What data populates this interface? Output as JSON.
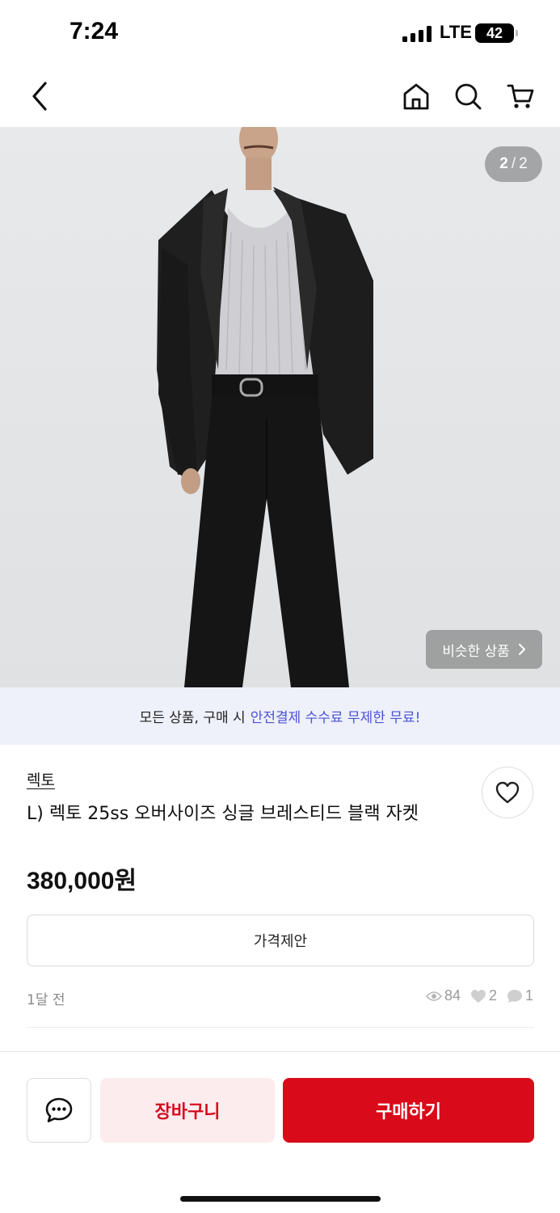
{
  "status_bar": {
    "time": "7:24",
    "network": "LTE",
    "battery": "42"
  },
  "nav": {
    "icons": [
      "back-icon",
      "home-icon",
      "search-icon",
      "cart-icon"
    ]
  },
  "hero": {
    "counter_current": "2",
    "counter_sep": "/",
    "counter_total": "2",
    "similar_label": "비슷한 상품"
  },
  "promo": {
    "text": "모든 상품, 구매 시",
    "highlight": "안전결제 수수료 무제한 무료!"
  },
  "product": {
    "brand": "렉토",
    "title": "L) 렉토 25ss 오버사이즈 싱글 브레스티드  블랙 자켓",
    "price": "380,000",
    "currency": "원",
    "offer_label": "가격제안",
    "time_ago": "1달 전",
    "views": "84",
    "likes": "2",
    "chats": "1"
  },
  "actions": {
    "cart_label": "장바구니",
    "buy_label": "구매하기"
  },
  "colors": {
    "accent": "#d90a19",
    "cart_bg": "#fdecee",
    "promo_bg": "#eef0fa",
    "promo_highlight": "#4a52d6"
  }
}
